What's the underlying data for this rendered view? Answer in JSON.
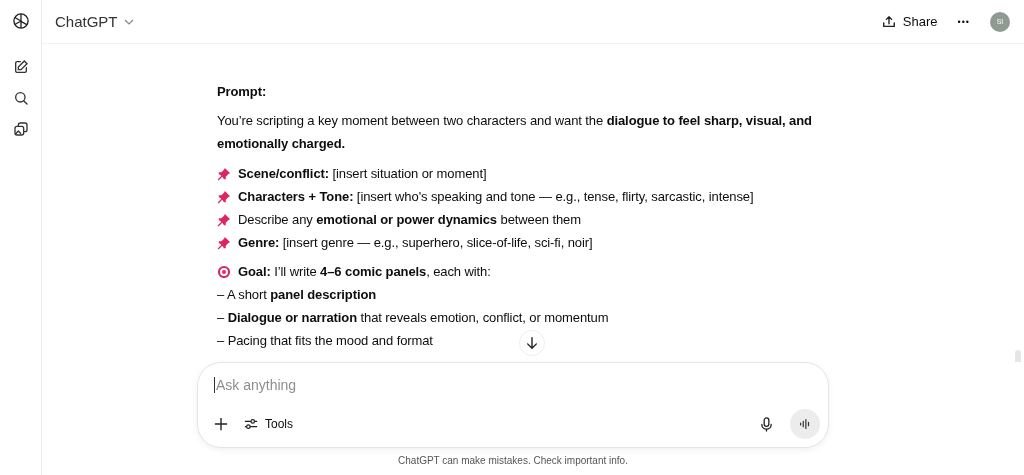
{
  "header": {
    "title": "ChatGPT",
    "share": "Share",
    "more": "•••",
    "avatar": "SI"
  },
  "message": {
    "heading": "Prompt:",
    "intro": "You’re scripting a key moment between two characters and want the **dialogue to feel sharp, visual, and emotionally charged.**",
    "bullets": [
      {
        "kind": "pin",
        "text": "**Scene/conflict:** [insert situation or moment]"
      },
      {
        "kind": "pin",
        "text": "**Characters + Tone:** [insert who's speaking and tone — e.g., tense, flirty, sarcastic, intense]"
      },
      {
        "kind": "pin",
        "text": "Describe any **emotional or power dynamics** between them"
      },
      {
        "kind": "pin",
        "text": "**Genre:** [insert genre — e.g., superhero, slice-of-life, sci-fi, noir]"
      }
    ],
    "goal": {
      "kind": "target",
      "text": "**Goal:** I’ll write **4–6 comic panels**, each with:"
    },
    "lines": [
      {
        "text": "– A short **panel description**"
      },
      {
        "text": "– **Dialogue or narration** that reveals emotion, conflict, or momentum"
      },
      {
        "text": "– Pacing that fits the mood and format"
      }
    ]
  },
  "composer": {
    "placeholder": "Ask anything",
    "tools": "Tools"
  },
  "footer": "ChatGPT can make mistakes. Check important info."
}
